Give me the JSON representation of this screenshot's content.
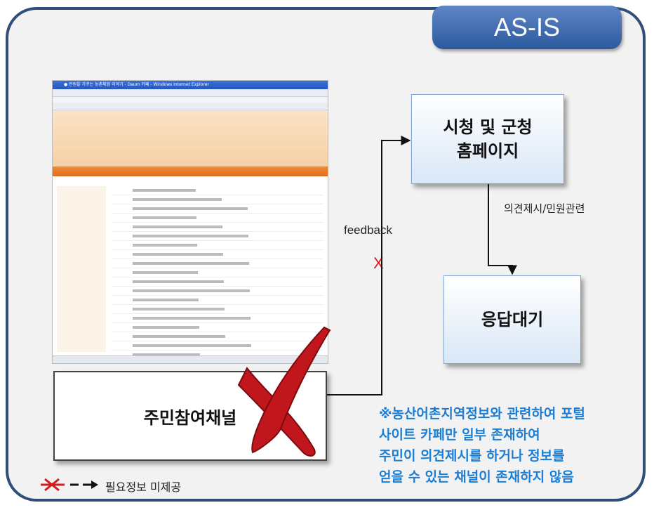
{
  "badge": {
    "label": "AS-IS"
  },
  "screenshot": {
    "window_title": "● 전원을 가꾸는 농촌체험 이야기 - Daum 카페 - Windows Internet Explorer"
  },
  "boxes": {
    "city_homepage": "시청 및 군청\n홈페이지",
    "waiting": "응답대기",
    "resident_channel": "주민참여채널"
  },
  "labels": {
    "opinion": "의견제시/민원관련",
    "feedback": "feedback",
    "x_mark": "X"
  },
  "note": "※농산어촌지역정보와 관련하여 포털\n  사이트 카페만 일부 존재하여\n  주민이 의견제시를 하거나 정보를\n  얻을 수 있는 채널이 존재하지 않음",
  "legend": {
    "label": "필요정보 미제공"
  },
  "colors": {
    "frame": "#2f4f7a",
    "badge": "#3e6db3",
    "note": "#1a7ed6",
    "x_red": "#d41a1a"
  }
}
